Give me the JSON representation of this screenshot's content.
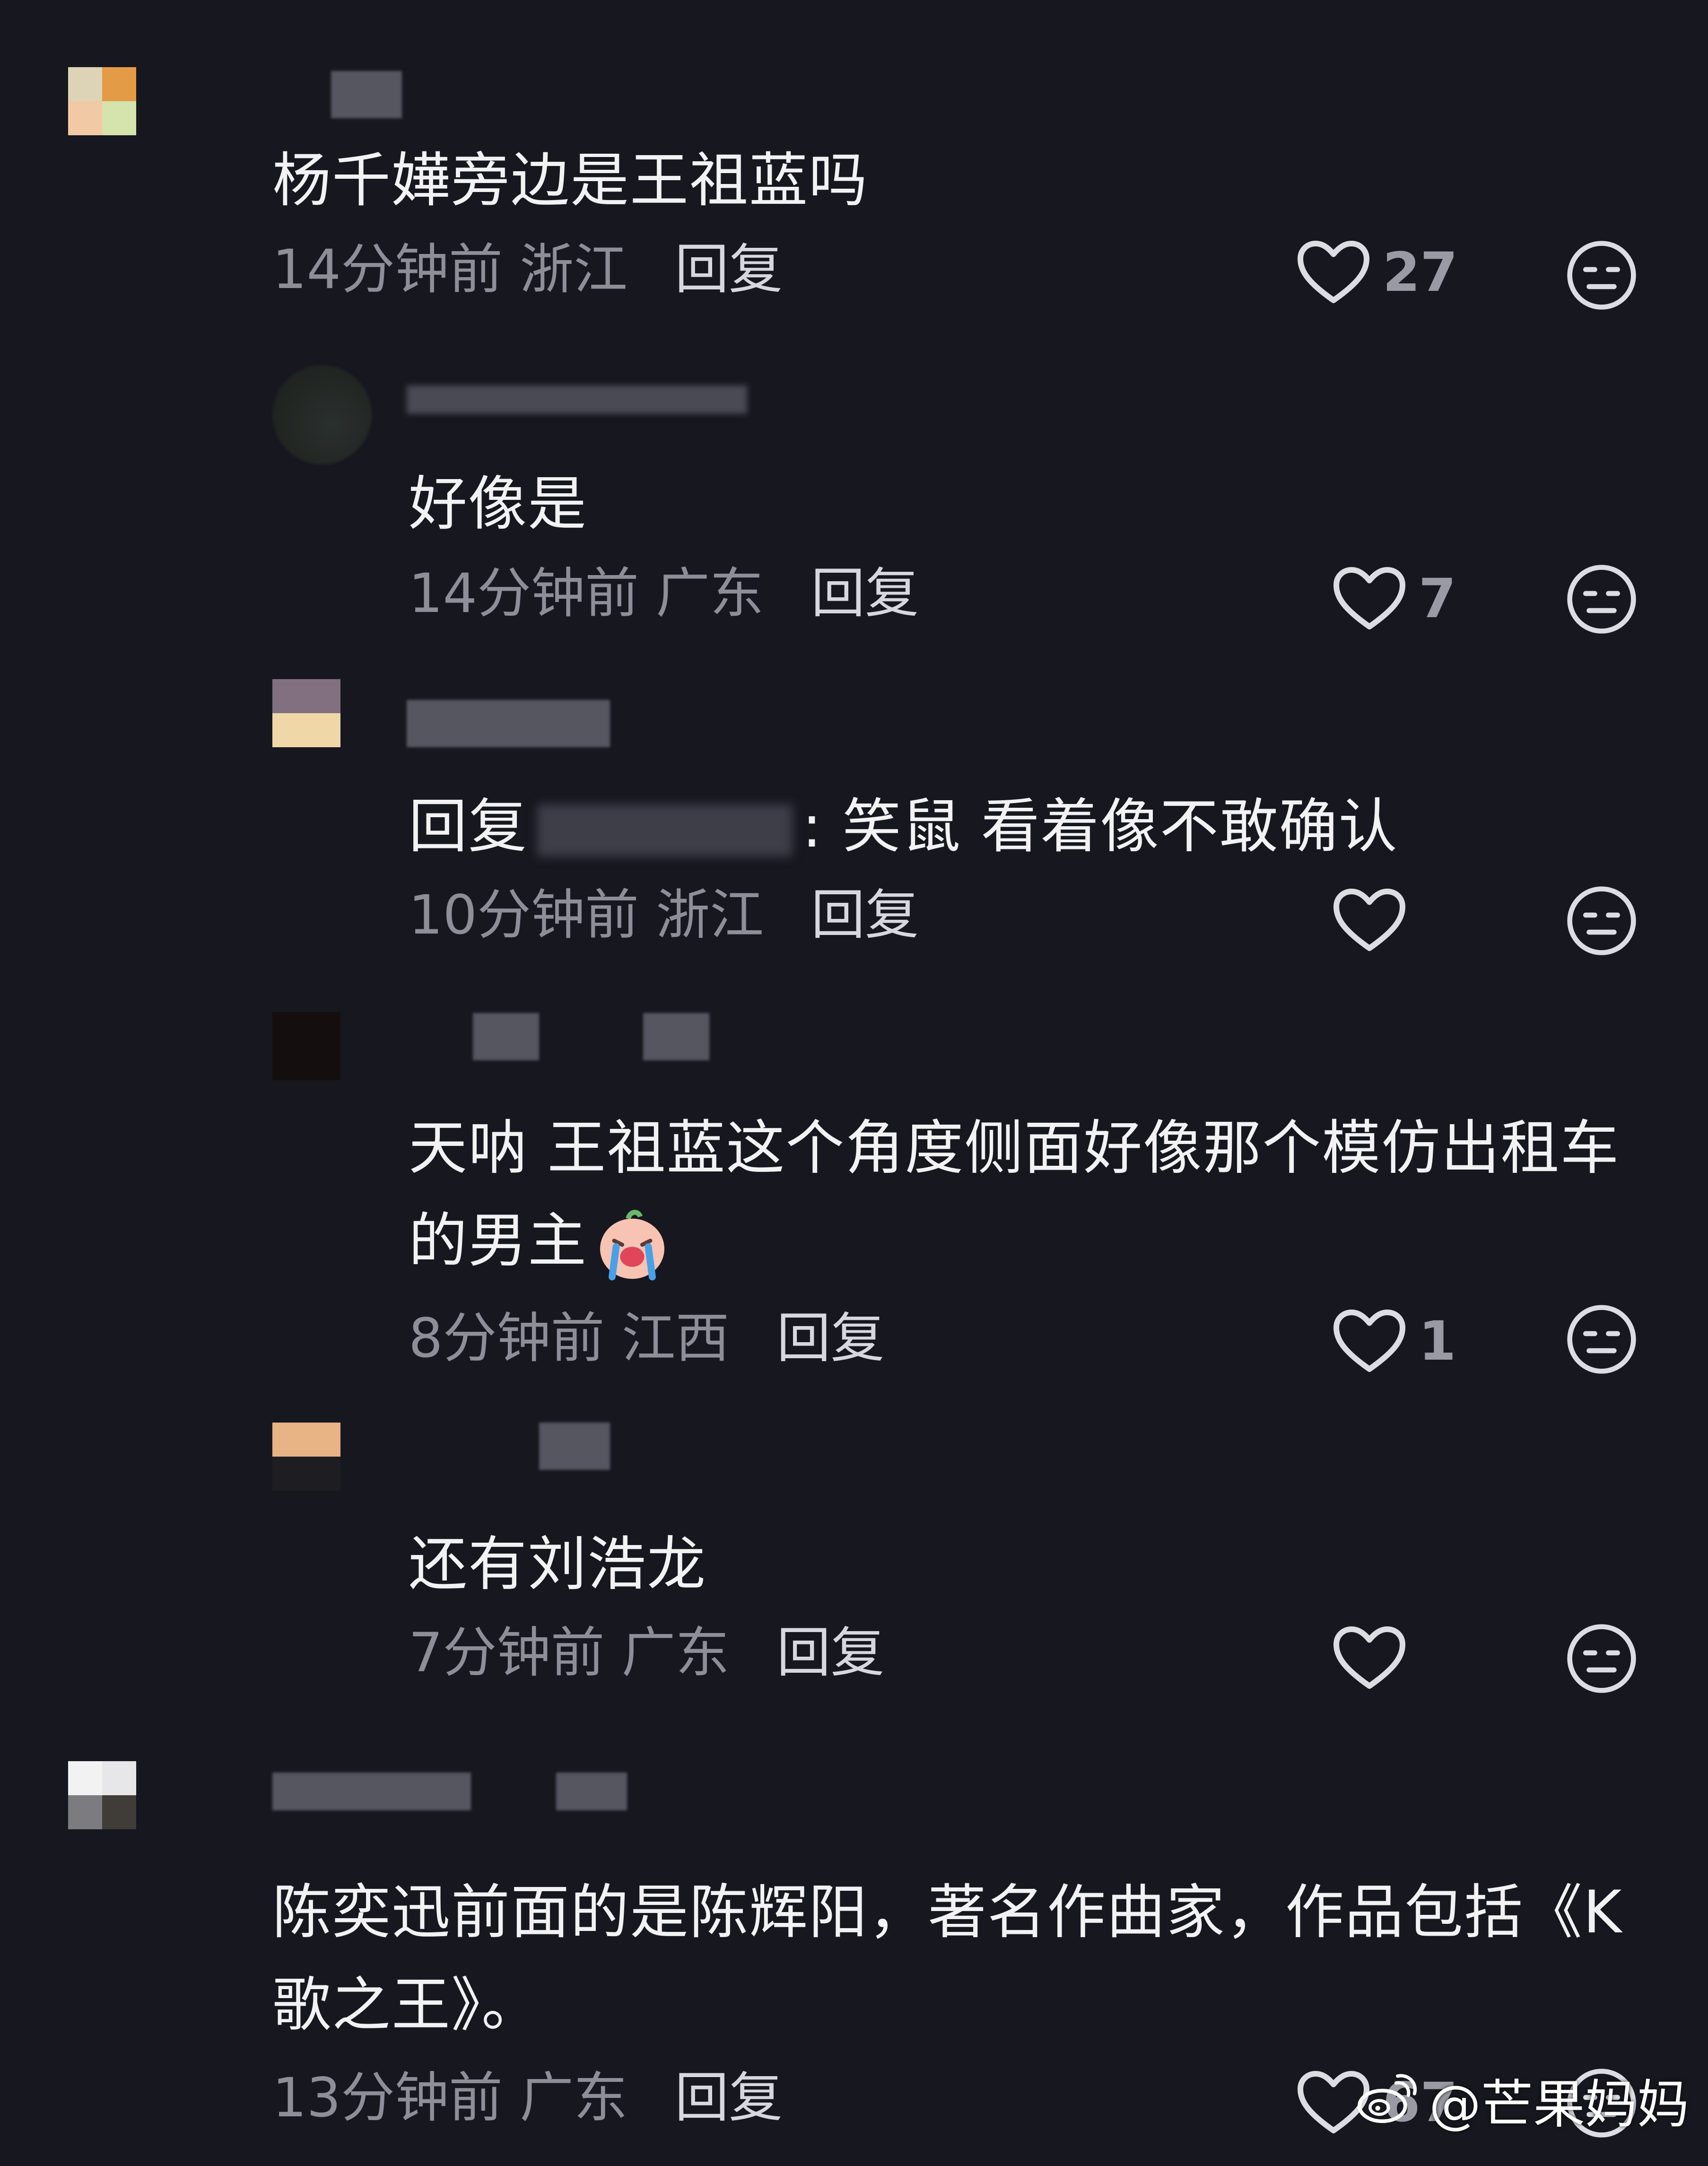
{
  "comments": [
    {
      "text": "杨千嬅旁边是王祖蓝吗",
      "time": "14分钟前",
      "location": "浙江",
      "reply_label": "回复",
      "likes": "27"
    },
    {
      "text": "好像是",
      "time": "14分钟前",
      "location": "广东",
      "reply_label": "回复",
      "likes": "7"
    },
    {
      "text_prefix": "回复",
      "text_suffix": ": 笑鼠 看着像不敢确认",
      "time": "10分钟前",
      "location": "浙江",
      "reply_label": "回复",
      "likes": ""
    },
    {
      "text_line1": "天呐 王祖蓝这个角度侧面好像那个模仿出租车",
      "text_line2": "的男主",
      "time": "8分钟前",
      "location": "江西",
      "reply_label": "回复",
      "likes": "1"
    },
    {
      "text": "还有刘浩龙",
      "time": "7分钟前",
      "location": "广东",
      "reply_label": "回复",
      "likes": ""
    },
    {
      "text_line1": "陈奕迅前面的是陈辉阳，著名作曲家，作品包括《K",
      "text_line2": "歌之王》。",
      "time": "13分钟前",
      "location": "广东",
      "reply_label": "回复",
      "likes": "67"
    }
  ],
  "watermark": {
    "text": "@芒果妈妈",
    "icon": "weibo-icon"
  },
  "icons": {
    "like": "heart-outline-icon",
    "react": "meh-face-icon",
    "emoji": "crying-face-emoji"
  },
  "colors": {
    "background": "#17171f",
    "text": "#f2f2f5",
    "meta": "#8e8e99"
  }
}
